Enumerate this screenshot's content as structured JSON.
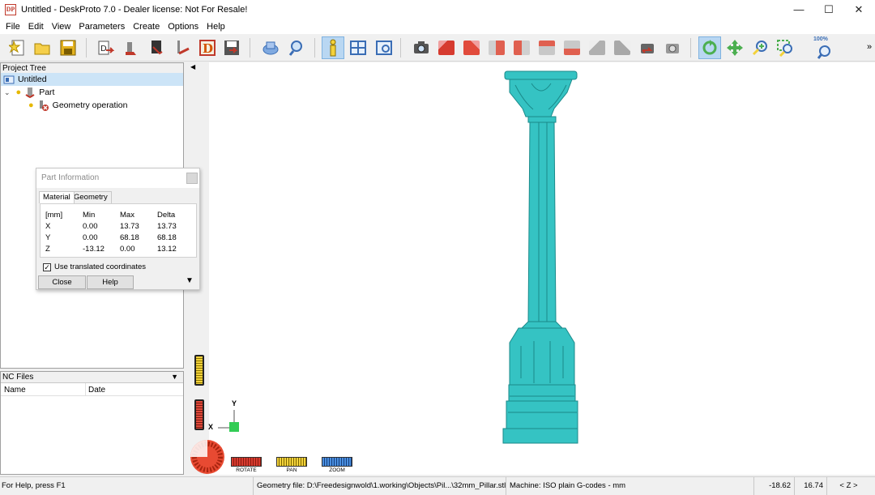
{
  "window": {
    "logo_text": "DP",
    "title": "Untitled - DeskProto 7.0 - Dealer license: Not For Resale!",
    "minimize": "—",
    "maximize": "☐",
    "close": "✕"
  },
  "menu": [
    "File",
    "Edit",
    "View",
    "Parameters",
    "Create",
    "Options",
    "Help"
  ],
  "toolbar": {
    "zoom_100_label": "100%",
    "overflow": "»"
  },
  "project_tree": {
    "header": "Project Tree",
    "root": "Untitled",
    "part": "Part",
    "operation": "Geometry operation"
  },
  "part_information": {
    "title": "Part Information",
    "tabs": [
      "Material",
      "Geometry"
    ],
    "columns": [
      "[mm]",
      "Min",
      "Max",
      "Delta"
    ],
    "rows": [
      {
        "axis": "X",
        "min": "0.00",
        "max": "13.73",
        "delta": "13.73"
      },
      {
        "axis": "Y",
        "min": "0.00",
        "max": "68.18",
        "delta": "68.18"
      },
      {
        "axis": "Z",
        "min": "-13.12",
        "max": "0.00",
        "delta": "13.12"
      }
    ],
    "checkbox_label": "Use translated coordinates",
    "checkbox_checked": true,
    "close_button": "Close",
    "help_button": "Help"
  },
  "nc_files": {
    "header": "NC Files",
    "columns": [
      "Name",
      "Date"
    ]
  },
  "viewport": {
    "axis_y": "Y",
    "axis_x": "X",
    "mode_buttons": [
      "ROTATE",
      "PAN",
      "ZOOM"
    ],
    "model_color": "#35c3c3"
  },
  "statusbar": {
    "help": "For Help, press F1",
    "geometry_file": "Geometry file: D:\\Freedesignwold\\1.working\\Objects\\Pil...\\32mm_Pillar.stl",
    "machine": "Machine: ISO plain G-codes - mm",
    "coord_x": "-18.62",
    "coord_y": "16.74",
    "axis": "< Z >"
  }
}
